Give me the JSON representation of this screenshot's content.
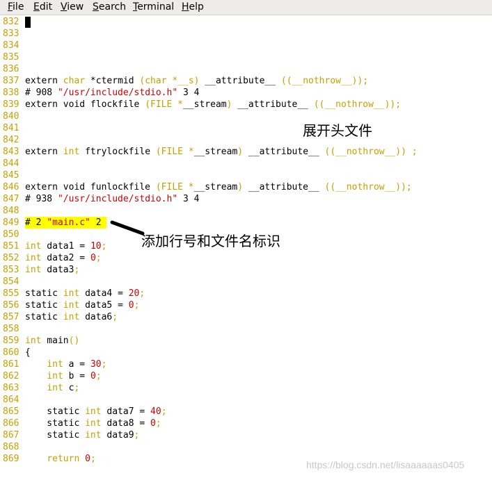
{
  "menubar": {
    "items": [
      {
        "mnemonic": "F",
        "rest": "ile"
      },
      {
        "mnemonic": "E",
        "rest": "dit"
      },
      {
        "mnemonic": "V",
        "rest": "iew"
      },
      {
        "mnemonic": "S",
        "rest": "earch"
      },
      {
        "mnemonic": "T",
        "rest": "erminal"
      },
      {
        "mnemonic": "H",
        "rest": "elp"
      }
    ]
  },
  "editor": {
    "lines": [
      {
        "no": "832",
        "segs": []
      },
      {
        "no": "833",
        "segs": []
      },
      {
        "no": "834",
        "segs": []
      },
      {
        "no": "835",
        "segs": []
      },
      {
        "no": "836",
        "segs": []
      },
      {
        "no": "837",
        "segs": [
          {
            "t": "extern ",
            "c": "pp"
          },
          {
            "t": "char",
            "c": "kw"
          },
          {
            "t": " *ctermid ",
            "c": "pp"
          },
          {
            "t": "(char *__s)",
            "c": "kw"
          },
          {
            "t": " __attribute__ ",
            "c": "pp"
          },
          {
            "t": "((__nothrow__));",
            "c": "kw"
          }
        ]
      },
      {
        "no": "838",
        "segs": [
          {
            "t": "# 908 ",
            "c": "pp"
          },
          {
            "t": "\"/usr/include/stdio.h\"",
            "c": "str"
          },
          {
            "t": " 3 4",
            "c": "pp"
          }
        ]
      },
      {
        "no": "839",
        "segs": [
          {
            "t": "extern void flockfile ",
            "c": "pp"
          },
          {
            "t": "(FILE *",
            "c": "kw"
          },
          {
            "t": "__stream",
            "c": "pp"
          },
          {
            "t": ")",
            "c": "kw"
          },
          {
            "t": " __attribute__ ",
            "c": "pp"
          },
          {
            "t": "((__nothrow__));",
            "c": "kw"
          }
        ]
      },
      {
        "no": "840",
        "segs": []
      },
      {
        "no": "841",
        "segs": []
      },
      {
        "no": "842",
        "segs": []
      },
      {
        "no": "843",
        "segs": [
          {
            "t": "extern ",
            "c": "pp"
          },
          {
            "t": "int",
            "c": "kw"
          },
          {
            "t": " ftrylockfile ",
            "c": "pp"
          },
          {
            "t": "(FILE *",
            "c": "kw"
          },
          {
            "t": "__stream",
            "c": "pp"
          },
          {
            "t": ")",
            "c": "kw"
          },
          {
            "t": " __attribute__ ",
            "c": "pp"
          },
          {
            "t": "((__nothrow__)) ;",
            "c": "kw"
          }
        ]
      },
      {
        "no": "844",
        "segs": []
      },
      {
        "no": "845",
        "segs": []
      },
      {
        "no": "846",
        "segs": [
          {
            "t": "extern void funlockfile ",
            "c": "pp"
          },
          {
            "t": "(FILE *",
            "c": "kw"
          },
          {
            "t": "__stream",
            "c": "pp"
          },
          {
            "t": ")",
            "c": "kw"
          },
          {
            "t": " __attribute__ ",
            "c": "pp"
          },
          {
            "t": "((__nothrow__));",
            "c": "kw"
          }
        ]
      },
      {
        "no": "847",
        "segs": [
          {
            "t": "# 938 ",
            "c": "pp"
          },
          {
            "t": "\"/usr/include/stdio.h\"",
            "c": "str"
          },
          {
            "t": " 3 4",
            "c": "pp"
          }
        ]
      },
      {
        "no": "848",
        "segs": []
      },
      {
        "no": "849",
        "hl": true,
        "segs": [
          {
            "t": "# 2 ",
            "c": "pp"
          },
          {
            "t": "\"main.c\"",
            "c": "str"
          },
          {
            "t": " 2 ",
            "c": "pp"
          }
        ]
      },
      {
        "no": "850",
        "segs": []
      },
      {
        "no": "851",
        "segs": [
          {
            "t": "int",
            "c": "kw"
          },
          {
            "t": " data1 = ",
            "c": "pp"
          },
          {
            "t": "10",
            "c": "num"
          },
          {
            "t": ";",
            "c": "kw"
          }
        ]
      },
      {
        "no": "852",
        "segs": [
          {
            "t": "int",
            "c": "kw"
          },
          {
            "t": " data2 = ",
            "c": "pp"
          },
          {
            "t": "0",
            "c": "num"
          },
          {
            "t": ";",
            "c": "kw"
          }
        ]
      },
      {
        "no": "853",
        "segs": [
          {
            "t": "int",
            "c": "kw"
          },
          {
            "t": " data3",
            "c": "pp"
          },
          {
            "t": ";",
            "c": "kw"
          }
        ]
      },
      {
        "no": "854",
        "segs": []
      },
      {
        "no": "855",
        "segs": [
          {
            "t": "static ",
            "c": "pp"
          },
          {
            "t": "int",
            "c": "kw"
          },
          {
            "t": " data4 = ",
            "c": "pp"
          },
          {
            "t": "20",
            "c": "num"
          },
          {
            "t": ";",
            "c": "kw"
          }
        ]
      },
      {
        "no": "856",
        "segs": [
          {
            "t": "static ",
            "c": "pp"
          },
          {
            "t": "int",
            "c": "kw"
          },
          {
            "t": " data5 = ",
            "c": "pp"
          },
          {
            "t": "0",
            "c": "num"
          },
          {
            "t": ";",
            "c": "kw"
          }
        ]
      },
      {
        "no": "857",
        "segs": [
          {
            "t": "static ",
            "c": "pp"
          },
          {
            "t": "int",
            "c": "kw"
          },
          {
            "t": " data6",
            "c": "pp"
          },
          {
            "t": ";",
            "c": "kw"
          }
        ]
      },
      {
        "no": "858",
        "segs": []
      },
      {
        "no": "859",
        "segs": [
          {
            "t": "int",
            "c": "kw"
          },
          {
            "t": " main",
            "c": "pp"
          },
          {
            "t": "()",
            "c": "kw"
          }
        ]
      },
      {
        "no": "860",
        "segs": [
          {
            "t": "{",
            "c": "pp"
          }
        ]
      },
      {
        "no": "861",
        "segs": [
          {
            "t": "    ",
            "c": "pp"
          },
          {
            "t": "int",
            "c": "kw"
          },
          {
            "t": " a = ",
            "c": "pp"
          },
          {
            "t": "30",
            "c": "num"
          },
          {
            "t": ";",
            "c": "kw"
          }
        ]
      },
      {
        "no": "862",
        "segs": [
          {
            "t": "    ",
            "c": "pp"
          },
          {
            "t": "int",
            "c": "kw"
          },
          {
            "t": " b = ",
            "c": "pp"
          },
          {
            "t": "0",
            "c": "num"
          },
          {
            "t": ";",
            "c": "kw"
          }
        ]
      },
      {
        "no": "863",
        "segs": [
          {
            "t": "    ",
            "c": "pp"
          },
          {
            "t": "int",
            "c": "kw"
          },
          {
            "t": " c",
            "c": "pp"
          },
          {
            "t": ";",
            "c": "kw"
          }
        ]
      },
      {
        "no": "864",
        "segs": []
      },
      {
        "no": "865",
        "segs": [
          {
            "t": "    static ",
            "c": "pp"
          },
          {
            "t": "int",
            "c": "kw"
          },
          {
            "t": " data7 = ",
            "c": "pp"
          },
          {
            "t": "40",
            "c": "num"
          },
          {
            "t": ";",
            "c": "kw"
          }
        ]
      },
      {
        "no": "866",
        "segs": [
          {
            "t": "    static ",
            "c": "pp"
          },
          {
            "t": "int",
            "c": "kw"
          },
          {
            "t": " data8 = ",
            "c": "pp"
          },
          {
            "t": "0",
            "c": "num"
          },
          {
            "t": ";",
            "c": "kw"
          }
        ]
      },
      {
        "no": "867",
        "segs": [
          {
            "t": "    static ",
            "c": "pp"
          },
          {
            "t": "int",
            "c": "kw"
          },
          {
            "t": " data9",
            "c": "pp"
          },
          {
            "t": ";",
            "c": "kw"
          }
        ]
      },
      {
        "no": "868",
        "segs": []
      },
      {
        "no": "869",
        "segs": [
          {
            "t": "    ",
            "c": "pp"
          },
          {
            "t": "return",
            "c": "kw"
          },
          {
            "t": " ",
            "c": "pp"
          },
          {
            "t": "0",
            "c": "num"
          },
          {
            "t": ";",
            "c": "kw"
          }
        ]
      }
    ]
  },
  "annotations": {
    "expand_header": "展开头文件",
    "add_marker": "添加行号和文件名标识"
  },
  "watermark": "https://blog.csdn.net/lisaaaaaas0405",
  "colors": {
    "line_number": "#c4a000",
    "keyword": "#c4a000",
    "literal": "#cc0000",
    "highlight": "#ffff00"
  }
}
